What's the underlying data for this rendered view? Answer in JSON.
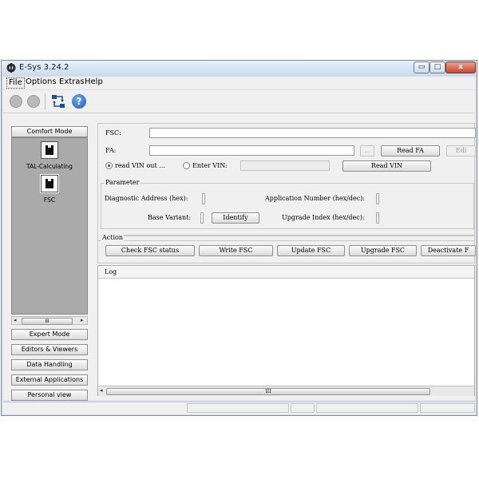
{
  "window": {
    "title": "E-Sys 3.24.2",
    "minimize_glyph": "▭",
    "maximize_glyph": "□",
    "close_glyph": "x"
  },
  "menu": [
    "File",
    "Options",
    "Extras",
    "Help"
  ],
  "toolbar": {
    "icons": [
      "back-icon",
      "forward-icon",
      "connect-icon",
      "help-icon"
    ],
    "help_glyph": "?"
  },
  "sidebar": {
    "comfort_mode": "Comfort Mode",
    "tools": [
      {
        "label": "TAL-Calculating",
        "icon": "chip-icon"
      },
      {
        "label": "FSC",
        "icon": "chip-icon",
        "selected": true
      }
    ],
    "scroll_thumb": "III",
    "scroll_left": "◂",
    "scroll_right": "▸",
    "modes": [
      "Expert Mode",
      "Editors & Viewers",
      "Data Handling",
      "External Applications",
      "Personal view"
    ]
  },
  "fsc_form": {
    "fsc_label": "FSC:",
    "fsc_value": "",
    "fa_label": "FA:",
    "fa_value": "",
    "browse_label": "...",
    "read_fa_label": "Read FA",
    "edit_label": "Edi",
    "read_vin_out_label": "read VIN out ...",
    "enter_vin_label": "Enter VIN:",
    "vin_value": "",
    "read_vin_label": "Read VIN",
    "selected_vin_mode": "read VIN out"
  },
  "parameter": {
    "title": "Parameter",
    "diag_label": "Diagnostic Address (hex):",
    "diag_value": "",
    "app_label": "Application Number (hex/dec):",
    "app_value": "",
    "base_variant_label": "Base Variant:",
    "base_variant_value": "",
    "identify_label": "Identify",
    "upgrade_label": "Upgrade Index (hex/dec):",
    "upgrade_value": ""
  },
  "action": {
    "title": "Action",
    "buttons": [
      "Check FSC status",
      "Write FSC",
      "Update FSC",
      "Upgrade FSC",
      "Deactivate F"
    ]
  },
  "log": {
    "title": "Log",
    "scroll_thumb": "III",
    "scroll_left": "◂"
  }
}
